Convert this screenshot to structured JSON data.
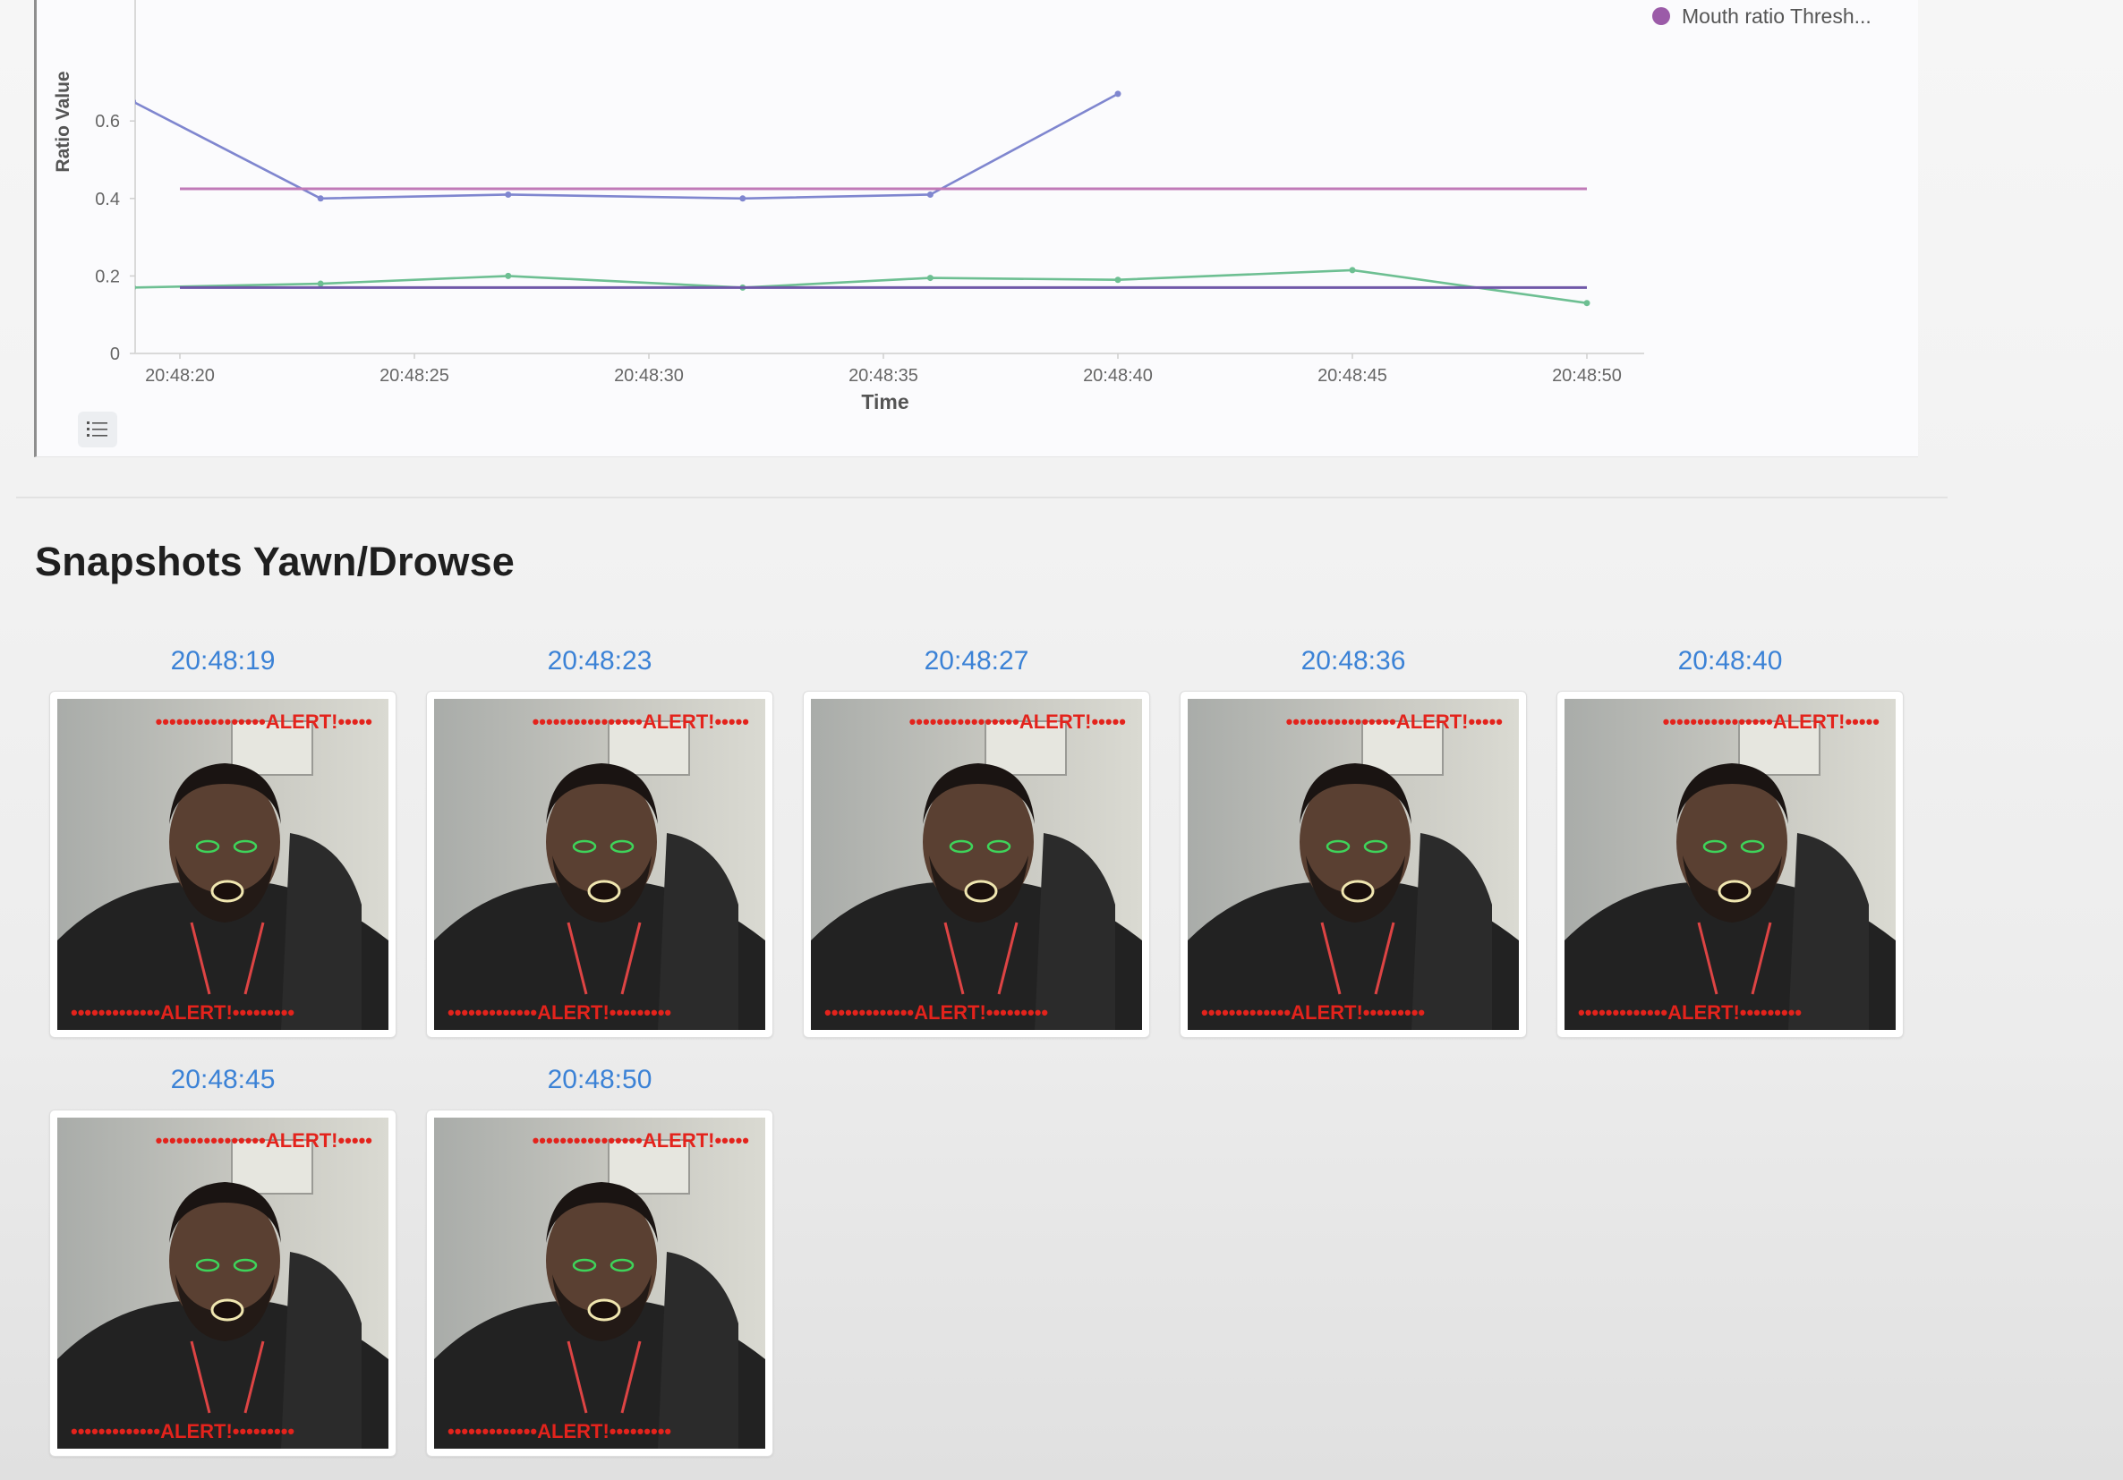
{
  "chart_data": {
    "type": "line",
    "title": "",
    "xlabel": "Time",
    "ylabel": "Ratio Value",
    "x_ticks": [
      "20:48:20",
      "20:48:25",
      "20:48:30",
      "20:48:35",
      "20:48:40",
      "20:48:45",
      "20:48:50"
    ],
    "y_ticks": [
      "0",
      "0.2",
      "0.4",
      "0.6"
    ],
    "x_range_seconds": [
      20,
      51
    ],
    "ylim": [
      0,
      0.6
    ],
    "x_seconds": [
      19,
      23,
      27,
      32,
      36,
      40,
      45,
      50
    ],
    "series": [
      {
        "name": "",
        "color": "#7f86cf",
        "values": [
          0.65,
          0.4,
          0.41,
          0.4,
          0.41,
          0.67,
          null,
          null
        ]
      },
      {
        "name": "",
        "color": "#6dbf92",
        "values": [
          0.17,
          0.18,
          0.2,
          0.17,
          0.195,
          0.19,
          0.215,
          0.13
        ]
      },
      {
        "name": "",
        "color": "#c07ab8",
        "constant": 0.425,
        "from_seconds": 20,
        "to_seconds": 50
      },
      {
        "name": "",
        "color": "#6f58a8",
        "constant": 0.17,
        "from_seconds": 20,
        "to_seconds": 50
      }
    ],
    "legend": [
      {
        "label": "Mouth ratio Thresh...",
        "color": "#9b5ba8"
      }
    ],
    "legend_position": "top-right",
    "grid": false
  },
  "section": {
    "title": "Snapshots Yawn/Drowse"
  },
  "snapshots": [
    {
      "time": "20:48:19",
      "alert": "ALERT!"
    },
    {
      "time": "20:48:23",
      "alert": "ALERT!"
    },
    {
      "time": "20:48:27",
      "alert": "ALERT!"
    },
    {
      "time": "20:48:36",
      "alert": "ALERT!"
    },
    {
      "time": "20:48:40",
      "alert": "ALERT!"
    },
    {
      "time": "20:48:45",
      "alert": "ALERT!"
    },
    {
      "time": "20:48:50",
      "alert": "ALERT!"
    }
  ],
  "icons": {
    "legend_toggle": "list-icon"
  }
}
